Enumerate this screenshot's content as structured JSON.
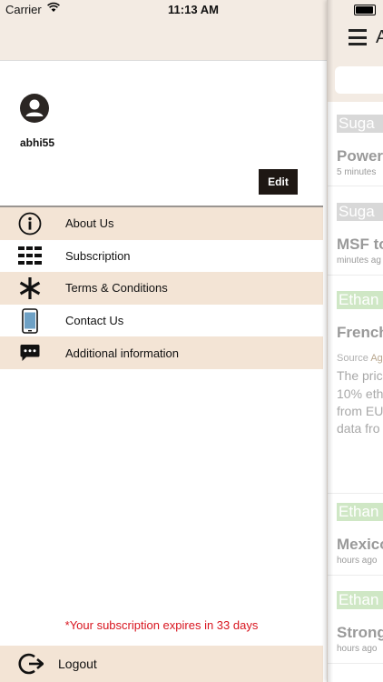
{
  "status_bar": {
    "carrier": "Carrier",
    "time": "11:13 AM"
  },
  "profile": {
    "username": "abhi55",
    "edit_label": "Edit"
  },
  "menu": {
    "items": [
      {
        "label": "About Us",
        "icon": "info-icon"
      },
      {
        "label": "Subscription",
        "icon": "list-icon"
      },
      {
        "label": "Terms & Conditions",
        "icon": "asterisk-icon"
      },
      {
        "label": "Contact Us",
        "icon": "phone-icon"
      },
      {
        "label": "Additional information",
        "icon": "chat-icon"
      }
    ]
  },
  "subscription_notice": "*Your subscription expires in 33 days",
  "logout_label": "Logout",
  "main_panel": {
    "nav_title_fragment": "A",
    "feed": [
      {
        "tag": "Suga",
        "title": "Power",
        "time": "5 minutes"
      },
      {
        "tag": "Suga",
        "title": "MSF to",
        "time": "minutes ag"
      },
      {
        "tag": "Ethan",
        "title": "French",
        "source_label": "Source",
        "source_value": "Ag",
        "body": [
          "The pric",
          "10% eth",
          "from EU",
          "data fro"
        ]
      },
      {
        "tag": "Ethan",
        "title": "Mexico",
        "time": "hours ago"
      },
      {
        "tag": "Ethan",
        "title": "Strong",
        "time": "hours ago"
      }
    ]
  },
  "colors": {
    "header_bg": "#f3ebe3",
    "menu_shade": "#f3e4d5",
    "edit_button": "#1e1713",
    "notice_red": "#d8141e",
    "tag_grey": "#d8d8d8",
    "tag_green": "#cfe7c5"
  }
}
